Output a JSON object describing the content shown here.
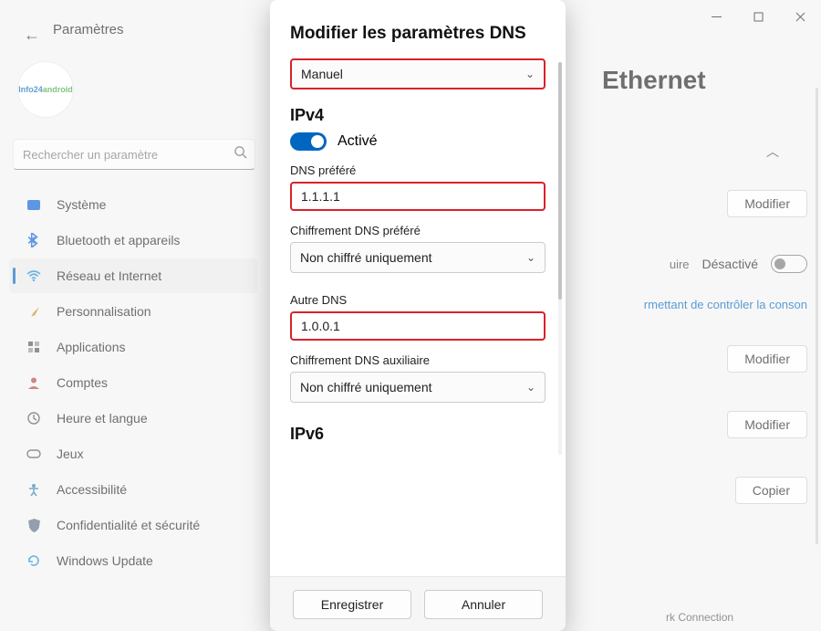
{
  "window": {
    "title": "Paramètres",
    "search_placeholder": "Rechercher un paramètre",
    "avatar_text1": "Info24",
    "avatar_text2": "android"
  },
  "nav": {
    "items": [
      {
        "label": "Système",
        "icon": "monitor",
        "color": "#0a5cd8"
      },
      {
        "label": "Bluetooth et appareils",
        "icon": "bt",
        "color": "#0a5cd8"
      },
      {
        "label": "Réseau et Internet",
        "icon": "wifi",
        "color": "#1a8cd8",
        "active": true
      },
      {
        "label": "Personnalisation",
        "icon": "brush",
        "color": "#c98828"
      },
      {
        "label": "Applications",
        "icon": "grid",
        "color": "#555"
      },
      {
        "label": "Comptes",
        "icon": "user",
        "color": "#b04848"
      },
      {
        "label": "Heure et langue",
        "icon": "clock",
        "color": "#555"
      },
      {
        "label": "Jeux",
        "icon": "game",
        "color": "#555"
      },
      {
        "label": "Accessibilité",
        "icon": "access",
        "color": "#2a7db0"
      },
      {
        "label": "Confidentialité et sécurité",
        "icon": "shield",
        "color": "#5b6a83"
      },
      {
        "label": "Windows Update",
        "icon": "update",
        "color": "#1a8cd8"
      }
    ]
  },
  "page": {
    "title": "Ethernet",
    "modify": "Modifier",
    "metered_label": "Désactivé",
    "metered_hint_partial_left": "uire",
    "data_link_partial": "rmettant de contrôler la conson",
    "copy": "Copier",
    "footer_partial": "rk Connection"
  },
  "modal": {
    "title": "Modifier les paramètres DNS",
    "mode": "Manuel",
    "ipv4_heading": "IPv4",
    "ipv4_toggle_label": "Activé",
    "preferred_label": "DNS préféré",
    "preferred_value": "1.1.1.1",
    "preferred_enc_label": "Chiffrement DNS préféré",
    "preferred_enc_value": "Non chiffré uniquement",
    "alt_label": "Autre DNS",
    "alt_value": "1.0.0.1",
    "alt_enc_label": "Chiffrement DNS auxiliaire",
    "alt_enc_value": "Non chiffré uniquement",
    "ipv6_heading": "IPv6",
    "save": "Enregistrer",
    "cancel": "Annuler"
  }
}
